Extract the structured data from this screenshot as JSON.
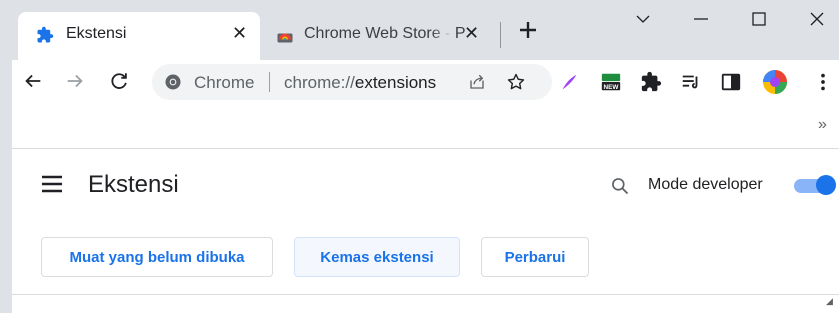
{
  "tabs": [
    {
      "title": "Ekstensi",
      "icon": "puzzle-icon",
      "active": true
    },
    {
      "title": "Chrome Web Store - P",
      "icon": "chrome-web-store-icon",
      "active": false
    }
  ],
  "tab_close_glyph": "✕",
  "omnibox": {
    "chip_label": "Chrome",
    "url_scheme": "chrome://",
    "url_host": "extensions"
  },
  "bookmarks_overflow": "»",
  "page": {
    "title": "Ekstensi",
    "developer_mode_label": "Mode developer",
    "developer_mode_on": true
  },
  "actions": [
    {
      "label": "Muat yang belum dibuka"
    },
    {
      "label": "Kemas ekstensi"
    },
    {
      "label": "Perbarui"
    }
  ],
  "colors": {
    "accent": "#1a73e8",
    "titlebar": "#dee1e6",
    "toggle_track": "#8ab4f8"
  }
}
